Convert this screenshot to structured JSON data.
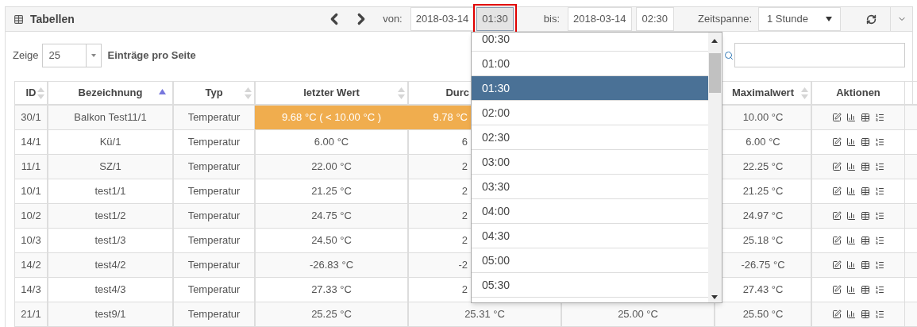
{
  "panel": {
    "title": "Tabellen",
    "von_label": "von:",
    "von_date": "2018-03-14",
    "von_time": {
      "value": "01:30",
      "open": true
    },
    "bis_label": "bis:",
    "bis_date": "2018-03-14",
    "bis_time": {
      "value": "02:30",
      "open": false
    },
    "zeitspanne_label": "Zeitspanne:",
    "zeitspanne_value": "1 Stunde"
  },
  "length_control": {
    "prefix": "Zeige",
    "value": "25",
    "suffix": "Einträge pro Seite"
  },
  "table": {
    "columns": [
      {
        "label": "ID",
        "sortable": true,
        "sorted": false
      },
      {
        "label": "Bezeichnung",
        "sortable": true,
        "sorted": true
      },
      {
        "label": "Typ",
        "sortable": true,
        "sorted": false
      },
      {
        "label": "letzter Wert",
        "sortable": true,
        "sorted": false
      },
      {
        "label": "Durc"
      },
      {},
      {
        "label": "Maximalwert",
        "sortable": true,
        "sorted": false
      },
      {
        "label": "Aktionen"
      }
    ],
    "rows": [
      {
        "cells": [
          "30/1",
          "Balkon Test11/1",
          "Temperatur",
          "9.68 °C ( < 10.00 °C )",
          "9.78 °C",
          null,
          "10.00 °C"
        ],
        "alert": true
      },
      {
        "cells": [
          "14/1",
          "Kü/1",
          "Temperatur",
          "6.00 °C",
          "6",
          null,
          "6.00 °C"
        ],
        "alert": false
      },
      {
        "cells": [
          "11/1",
          "SZ/1",
          "Temperatur",
          "22.00 °C",
          "2",
          null,
          "22.25 °C"
        ],
        "alert": false
      },
      {
        "cells": [
          "10/1",
          "test1/1",
          "Temperatur",
          "21.25 °C",
          "2",
          null,
          "21.25 °C"
        ],
        "alert": false
      },
      {
        "cells": [
          "10/2",
          "test1/2",
          "Temperatur",
          "24.75 °C",
          "2",
          null,
          "24.97 °C"
        ],
        "alert": false
      },
      {
        "cells": [
          "10/3",
          "test1/3",
          "Temperatur",
          "24.50 °C",
          "2",
          null,
          "25.18 °C"
        ],
        "alert": false
      },
      {
        "cells": [
          "14/2",
          "test4/2",
          "Temperatur",
          "-26.83 °C",
          "-2",
          null,
          "-26.75 °C"
        ],
        "alert": false
      },
      {
        "cells": [
          "14/3",
          "test4/3",
          "Temperatur",
          "27.33 °C",
          "2",
          null,
          "27.43 °C"
        ],
        "alert": false
      },
      {
        "cells": [
          "21/1",
          "test9/1",
          "Temperatur",
          "25.25 °C",
          "25.31 °C",
          "25.00 °C",
          "25.50 °C"
        ],
        "alert": false
      }
    ]
  },
  "time_dropdown": {
    "items": [
      {
        "label": "00:30",
        "selected": false
      },
      {
        "label": "01:00",
        "selected": false
      },
      {
        "label": "01:30",
        "selected": true
      },
      {
        "label": "02:00",
        "selected": false
      },
      {
        "label": "02:30",
        "selected": false
      },
      {
        "label": "03:00",
        "selected": false
      },
      {
        "label": "03:30",
        "selected": false
      },
      {
        "label": "04:00",
        "selected": false
      },
      {
        "label": "04:30",
        "selected": false
      },
      {
        "label": "05:00",
        "selected": false
      },
      {
        "label": "05:30",
        "selected": false
      }
    ]
  }
}
